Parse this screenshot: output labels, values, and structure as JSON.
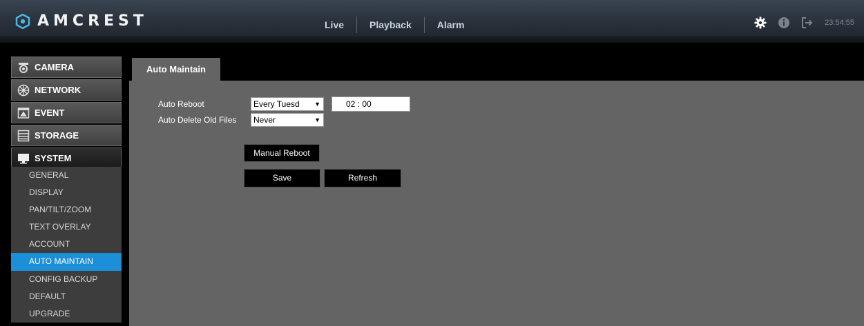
{
  "brand": {
    "name": "AMCREST"
  },
  "nav": {
    "items": [
      "Live",
      "Playback",
      "Alarm"
    ]
  },
  "toolbar": {
    "clock": "23:54:55",
    "icons": [
      "gear-icon",
      "info-icon",
      "logout-icon"
    ]
  },
  "sidebar": {
    "main_menu": [
      {
        "label": "CAMERA",
        "icon": "camera-icon"
      },
      {
        "label": "NETWORK",
        "icon": "network-icon"
      },
      {
        "label": "EVENT",
        "icon": "event-icon"
      },
      {
        "label": "STORAGE",
        "icon": "storage-icon"
      },
      {
        "label": "SYSTEM",
        "icon": "monitor-icon",
        "active": true
      }
    ],
    "sub_menu": [
      {
        "label": "GENERAL"
      },
      {
        "label": "DISPLAY"
      },
      {
        "label": "PAN/TILT/ZOOM"
      },
      {
        "label": "TEXT OVERLAY"
      },
      {
        "label": "ACCOUNT"
      },
      {
        "label": "AUTO MAINTAIN",
        "active": true
      },
      {
        "label": "CONFIG BACKUP"
      },
      {
        "label": "DEFAULT"
      },
      {
        "label": "UPGRADE"
      }
    ]
  },
  "page": {
    "tab": "Auto Maintain",
    "auto_reboot": {
      "label": "Auto Reboot",
      "day": "Every Tuesd",
      "time": "02 : 00"
    },
    "auto_delete": {
      "label": "Auto Delete Old Files",
      "value": "Never"
    },
    "buttons": {
      "manual_reboot": "Manual Reboot",
      "save": "Save",
      "refresh": "Refresh"
    }
  },
  "colors": {
    "accent": "#1d8ed8",
    "panel": "#646464",
    "sidebar_bg": "#000000"
  }
}
